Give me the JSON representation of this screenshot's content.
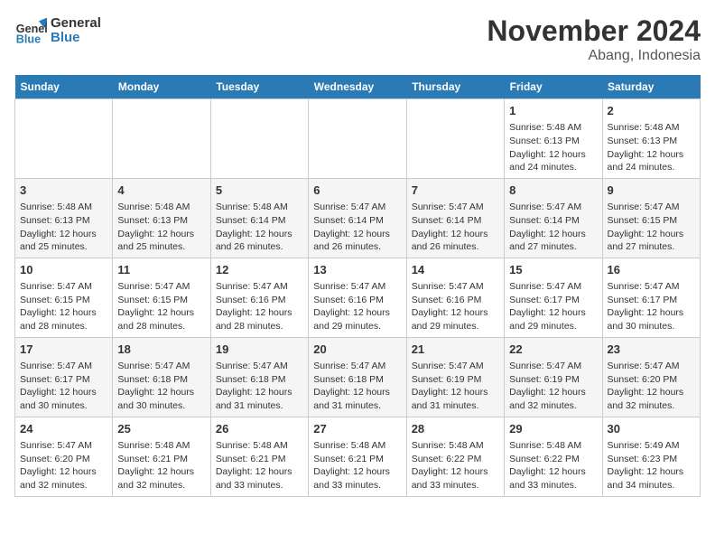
{
  "logo": {
    "line1": "General",
    "line2": "Blue"
  },
  "title": "November 2024",
  "subtitle": "Abang, Indonesia",
  "days_of_week": [
    "Sunday",
    "Monday",
    "Tuesday",
    "Wednesday",
    "Thursday",
    "Friday",
    "Saturday"
  ],
  "weeks": [
    [
      {
        "day": "",
        "content": ""
      },
      {
        "day": "",
        "content": ""
      },
      {
        "day": "",
        "content": ""
      },
      {
        "day": "",
        "content": ""
      },
      {
        "day": "",
        "content": ""
      },
      {
        "day": "1",
        "content": "Sunrise: 5:48 AM\nSunset: 6:13 PM\nDaylight: 12 hours and 24 minutes."
      },
      {
        "day": "2",
        "content": "Sunrise: 5:48 AM\nSunset: 6:13 PM\nDaylight: 12 hours and 24 minutes."
      }
    ],
    [
      {
        "day": "3",
        "content": "Sunrise: 5:48 AM\nSunset: 6:13 PM\nDaylight: 12 hours and 25 minutes."
      },
      {
        "day": "4",
        "content": "Sunrise: 5:48 AM\nSunset: 6:13 PM\nDaylight: 12 hours and 25 minutes."
      },
      {
        "day": "5",
        "content": "Sunrise: 5:48 AM\nSunset: 6:14 PM\nDaylight: 12 hours and 26 minutes."
      },
      {
        "day": "6",
        "content": "Sunrise: 5:47 AM\nSunset: 6:14 PM\nDaylight: 12 hours and 26 minutes."
      },
      {
        "day": "7",
        "content": "Sunrise: 5:47 AM\nSunset: 6:14 PM\nDaylight: 12 hours and 26 minutes."
      },
      {
        "day": "8",
        "content": "Sunrise: 5:47 AM\nSunset: 6:14 PM\nDaylight: 12 hours and 27 minutes."
      },
      {
        "day": "9",
        "content": "Sunrise: 5:47 AM\nSunset: 6:15 PM\nDaylight: 12 hours and 27 minutes."
      }
    ],
    [
      {
        "day": "10",
        "content": "Sunrise: 5:47 AM\nSunset: 6:15 PM\nDaylight: 12 hours and 28 minutes."
      },
      {
        "day": "11",
        "content": "Sunrise: 5:47 AM\nSunset: 6:15 PM\nDaylight: 12 hours and 28 minutes."
      },
      {
        "day": "12",
        "content": "Sunrise: 5:47 AM\nSunset: 6:16 PM\nDaylight: 12 hours and 28 minutes."
      },
      {
        "day": "13",
        "content": "Sunrise: 5:47 AM\nSunset: 6:16 PM\nDaylight: 12 hours and 29 minutes."
      },
      {
        "day": "14",
        "content": "Sunrise: 5:47 AM\nSunset: 6:16 PM\nDaylight: 12 hours and 29 minutes."
      },
      {
        "day": "15",
        "content": "Sunrise: 5:47 AM\nSunset: 6:17 PM\nDaylight: 12 hours and 29 minutes."
      },
      {
        "day": "16",
        "content": "Sunrise: 5:47 AM\nSunset: 6:17 PM\nDaylight: 12 hours and 30 minutes."
      }
    ],
    [
      {
        "day": "17",
        "content": "Sunrise: 5:47 AM\nSunset: 6:17 PM\nDaylight: 12 hours and 30 minutes."
      },
      {
        "day": "18",
        "content": "Sunrise: 5:47 AM\nSunset: 6:18 PM\nDaylight: 12 hours and 30 minutes."
      },
      {
        "day": "19",
        "content": "Sunrise: 5:47 AM\nSunset: 6:18 PM\nDaylight: 12 hours and 31 minutes."
      },
      {
        "day": "20",
        "content": "Sunrise: 5:47 AM\nSunset: 6:18 PM\nDaylight: 12 hours and 31 minutes."
      },
      {
        "day": "21",
        "content": "Sunrise: 5:47 AM\nSunset: 6:19 PM\nDaylight: 12 hours and 31 minutes."
      },
      {
        "day": "22",
        "content": "Sunrise: 5:47 AM\nSunset: 6:19 PM\nDaylight: 12 hours and 32 minutes."
      },
      {
        "day": "23",
        "content": "Sunrise: 5:47 AM\nSunset: 6:20 PM\nDaylight: 12 hours and 32 minutes."
      }
    ],
    [
      {
        "day": "24",
        "content": "Sunrise: 5:47 AM\nSunset: 6:20 PM\nDaylight: 12 hours and 32 minutes."
      },
      {
        "day": "25",
        "content": "Sunrise: 5:48 AM\nSunset: 6:21 PM\nDaylight: 12 hours and 32 minutes."
      },
      {
        "day": "26",
        "content": "Sunrise: 5:48 AM\nSunset: 6:21 PM\nDaylight: 12 hours and 33 minutes."
      },
      {
        "day": "27",
        "content": "Sunrise: 5:48 AM\nSunset: 6:21 PM\nDaylight: 12 hours and 33 minutes."
      },
      {
        "day": "28",
        "content": "Sunrise: 5:48 AM\nSunset: 6:22 PM\nDaylight: 12 hours and 33 minutes."
      },
      {
        "day": "29",
        "content": "Sunrise: 5:48 AM\nSunset: 6:22 PM\nDaylight: 12 hours and 33 minutes."
      },
      {
        "day": "30",
        "content": "Sunrise: 5:49 AM\nSunset: 6:23 PM\nDaylight: 12 hours and 34 minutes."
      }
    ]
  ]
}
